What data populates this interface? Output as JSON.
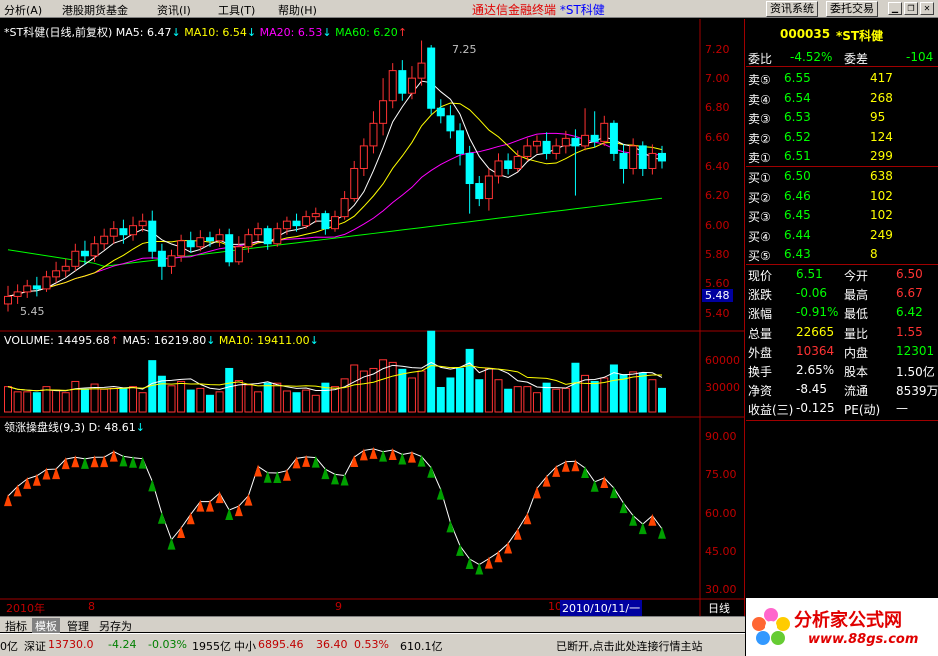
{
  "menu": {
    "items": [
      "分析(A)",
      "港股期货基金",
      "资讯(I)",
      "工具(T)",
      "帮助(H)"
    ],
    "title_prefix": "通达信金融终端",
    "title_stock": "*ST科健",
    "buttons": [
      "资讯系统",
      "委托交易"
    ]
  },
  "price_panel": {
    "name": "*ST科健(日线,前复权)",
    "ma5": "MA5: 6.47",
    "ma10": "MA10: 6.54",
    "ma20": "MA20: 6.53",
    "ma60": "MA60: 6.20",
    "high_label": "7.25",
    "low_label": "5.45",
    "cur_price_label": "5.48",
    "yticks": [
      "7.20",
      "7.00",
      "6.80",
      "6.60",
      "6.40",
      "6.20",
      "6.00",
      "5.80",
      "5.60",
      "5.40"
    ]
  },
  "volume_panel": {
    "label": "VOLUME: 14495.68",
    "ma5": "MA5: 16219.80",
    "ma10": "MA10: 19411.00",
    "yticks": [
      "60000",
      "30000"
    ]
  },
  "indicator_panel": {
    "label": "领涨操盘线(9,3)",
    "d": "D: 48.61",
    "yticks": [
      "90.00",
      "75.00",
      "60.00",
      "45.00",
      "30.00"
    ]
  },
  "xaxis": {
    "labels": [
      "2010年",
      "8",
      "9",
      "10"
    ],
    "cursor_date": "2010/10/11/一",
    "period": "日线"
  },
  "quote": {
    "code": "000035",
    "name": "*ST科健",
    "weibi_label": "委比",
    "weibi": "-4.52%",
    "weicha_label": "委差",
    "weicha": "-104",
    "asks": [
      {
        "label": "卖⑤",
        "price": "6.55",
        "vol": "417"
      },
      {
        "label": "卖④",
        "price": "6.54",
        "vol": "268"
      },
      {
        "label": "卖③",
        "price": "6.53",
        "vol": "95"
      },
      {
        "label": "卖②",
        "price": "6.52",
        "vol": "124"
      },
      {
        "label": "卖①",
        "price": "6.51",
        "vol": "299"
      }
    ],
    "bids": [
      {
        "label": "买①",
        "price": "6.50",
        "vol": "638"
      },
      {
        "label": "买②",
        "price": "6.46",
        "vol": "102"
      },
      {
        "label": "买③",
        "price": "6.45",
        "vol": "102"
      },
      {
        "label": "买④",
        "price": "6.44",
        "vol": "249"
      },
      {
        "label": "买⑤",
        "price": "6.43",
        "vol": "8"
      }
    ],
    "stats": [
      {
        "l1": "现价",
        "v1": "6.51",
        "l2": "今开",
        "v2": "6.50",
        "c1": "#00ff00",
        "c2": "#ff3333"
      },
      {
        "l1": "涨跌",
        "v1": "-0.06",
        "l2": "最高",
        "v2": "6.67",
        "c1": "#00ff00",
        "c2": "#ff3333"
      },
      {
        "l1": "涨幅",
        "v1": "-0.91%",
        "l2": "最低",
        "v2": "6.42",
        "c1": "#00ff00",
        "c2": "#00ff00"
      },
      {
        "l1": "总量",
        "v1": "22665",
        "l2": "量比",
        "v2": "1.55",
        "c1": "#ffff00",
        "c2": "#ff3333"
      },
      {
        "l1": "外盘",
        "v1": "10364",
        "l2": "内盘",
        "v2": "12301",
        "c1": "#ff3333",
        "c2": "#00ff00"
      },
      {
        "l1": "换手",
        "v1": "2.65%",
        "l2": "股本",
        "v2": "1.50亿",
        "c1": "#ffffff",
        "c2": "#ffffff"
      },
      {
        "l1": "净资",
        "v1": "-8.45",
        "l2": "流通",
        "v2": "8539万",
        "c1": "#ffffff",
        "c2": "#ffffff"
      },
      {
        "l1": "收益(三)",
        "v1": "-0.125",
        "l2": "PE(动)",
        "v2": "—",
        "c1": "#ffffff",
        "c2": "#ffffff"
      }
    ]
  },
  "tabs": [
    "指标",
    "模板",
    "管理",
    "另存为"
  ],
  "status": {
    "t0": "0亿",
    "t1": "深证",
    "t1v": "13730.0",
    "t1c": "-4.24",
    "t1p": "-0.03%",
    "t1a": "1955亿",
    "t2": "中小",
    "t2v": "6895.46",
    "t2c": "36.40",
    "t2p": "0.53%",
    "t2a": "610.1亿",
    "msg": "已断开,点击此处连接行情主站"
  },
  "brand": {
    "name": "分析家公式网",
    "url": "www.88gs.com"
  },
  "colors": {
    "up": "#ff3333",
    "down": "#00ffff",
    "ma5": "#ffffff",
    "ma10": "#ffff00",
    "ma20": "#ff00ff",
    "ma60": "#00ff00"
  },
  "chart_data": {
    "type": "candlestick",
    "price_range": [
      5.4,
      7.3
    ],
    "candles": [
      [
        5.5,
        5.55,
        5.45,
        5.62
      ],
      [
        5.55,
        5.58,
        5.5,
        5.63
      ],
      [
        5.58,
        5.62,
        5.54,
        5.66
      ],
      [
        5.62,
        5.6,
        5.55,
        5.68
      ],
      [
        5.6,
        5.68,
        5.58,
        5.72
      ],
      [
        5.68,
        5.72,
        5.64,
        5.78
      ],
      [
        5.72,
        5.75,
        5.68,
        5.8
      ],
      [
        5.75,
        5.85,
        5.72,
        5.9
      ],
      [
        5.85,
        5.82,
        5.76,
        5.92
      ],
      [
        5.82,
        5.9,
        5.78,
        5.95
      ],
      [
        5.9,
        5.95,
        5.86,
        6.0
      ],
      [
        5.95,
        6.0,
        5.9,
        6.05
      ],
      [
        6.0,
        5.96,
        5.9,
        6.06
      ],
      [
        5.96,
        6.02,
        5.92,
        6.08
      ],
      [
        6.02,
        6.05,
        5.98,
        6.1
      ],
      [
        6.05,
        5.85,
        5.8,
        6.12
      ],
      [
        5.85,
        5.75,
        5.66,
        5.9
      ],
      [
        5.75,
        5.82,
        5.7,
        5.86
      ],
      [
        5.82,
        5.92,
        5.78,
        5.96
      ],
      [
        5.92,
        5.88,
        5.84,
        5.98
      ],
      [
        5.88,
        5.94,
        5.85,
        5.99
      ],
      [
        5.94,
        5.92,
        5.88,
        5.98
      ],
      [
        5.92,
        5.96,
        5.88,
        6.0
      ],
      [
        5.96,
        5.78,
        5.75,
        6.0
      ],
      [
        5.78,
        5.88,
        5.76,
        5.95
      ],
      [
        5.88,
        5.96,
        5.84,
        6.0
      ],
      [
        5.96,
        6.0,
        5.92,
        6.04
      ],
      [
        6.0,
        5.9,
        5.86,
        6.02
      ],
      [
        5.9,
        6.0,
        5.88,
        6.04
      ],
      [
        6.0,
        6.05,
        5.96,
        6.08
      ],
      [
        6.05,
        6.02,
        5.98,
        6.1
      ],
      [
        6.02,
        6.08,
        6.0,
        6.12
      ],
      [
        6.08,
        6.1,
        6.04,
        6.14
      ],
      [
        6.1,
        6.0,
        5.96,
        6.12
      ],
      [
        6.0,
        6.08,
        5.98,
        6.12
      ],
      [
        6.08,
        6.2,
        6.06,
        6.25
      ],
      [
        6.2,
        6.4,
        6.18,
        6.45
      ],
      [
        6.4,
        6.55,
        6.35,
        6.6
      ],
      [
        6.55,
        6.7,
        6.5,
        6.78
      ],
      [
        6.7,
        6.85,
        6.62,
        7.0
      ],
      [
        6.85,
        7.05,
        6.8,
        7.1
      ],
      [
        7.05,
        6.9,
        6.85,
        7.12
      ],
      [
        6.9,
        7.0,
        6.86,
        7.08
      ],
      [
        7.0,
        7.1,
        6.95,
        7.25
      ],
      [
        7.2,
        6.8,
        6.76,
        7.22
      ],
      [
        6.8,
        6.75,
        6.7,
        6.86
      ],
      [
        6.75,
        6.65,
        6.6,
        6.82
      ],
      [
        6.65,
        6.5,
        6.42,
        6.7
      ],
      [
        6.5,
        6.3,
        6.1,
        6.55
      ],
      [
        6.3,
        6.2,
        6.15,
        6.35
      ],
      [
        6.2,
        6.35,
        6.12,
        6.4
      ],
      [
        6.35,
        6.45,
        6.3,
        6.5
      ],
      [
        6.45,
        6.4,
        6.36,
        6.5
      ],
      [
        6.4,
        6.48,
        6.38,
        6.52
      ],
      [
        6.48,
        6.55,
        6.45,
        6.6
      ],
      [
        6.55,
        6.58,
        6.5,
        6.62
      ],
      [
        6.58,
        6.5,
        6.46,
        6.64
      ],
      [
        6.5,
        6.55,
        6.46,
        6.6
      ],
      [
        6.55,
        6.6,
        6.5,
        6.65
      ],
      [
        6.6,
        6.55,
        6.22,
        6.66
      ],
      [
        6.55,
        6.62,
        6.52,
        6.8
      ],
      [
        6.62,
        6.58,
        6.54,
        6.78
      ],
      [
        6.58,
        6.7,
        6.55,
        6.75
      ],
      [
        6.7,
        6.5,
        6.45,
        6.72
      ],
      [
        6.5,
        6.4,
        6.3,
        6.56
      ],
      [
        6.4,
        6.55,
        6.36,
        6.6
      ],
      [
        6.55,
        6.4,
        6.35,
        6.58
      ],
      [
        6.4,
        6.5,
        6.36,
        6.56
      ],
      [
        6.5,
        6.45,
        6.4,
        6.55
      ]
    ],
    "volume_range": [
      0,
      80000
    ],
    "indicator_range": [
      25,
      95
    ]
  }
}
